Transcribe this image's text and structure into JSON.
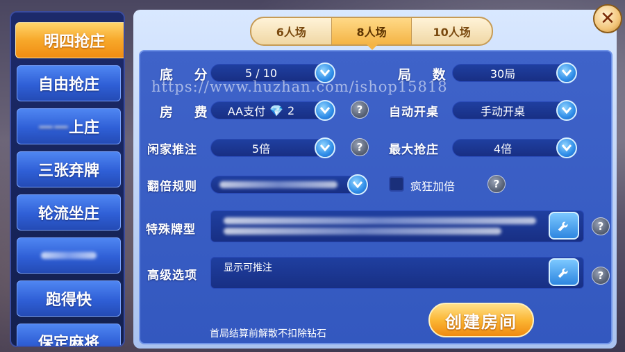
{
  "sidebar": {
    "items": [
      {
        "label": "明四抢庄"
      },
      {
        "label": "自由抢庄"
      },
      {
        "label": "上庄"
      },
      {
        "label": "三张弃牌"
      },
      {
        "label": "轮流坐庄"
      },
      {
        "label": ""
      },
      {
        "label": "跑得快"
      },
      {
        "label": "保定麻将"
      }
    ]
  },
  "tabs": [
    {
      "label": "6人场"
    },
    {
      "label": "8人场"
    },
    {
      "label": "10人场"
    }
  ],
  "close": {
    "label": "✕"
  },
  "form": {
    "difen": {
      "label": "底 分",
      "value": "5 / 10"
    },
    "jushu": {
      "label": "局 数",
      "value": "30局"
    },
    "fangfei": {
      "label": "房 费",
      "value_prefix": "AA支付",
      "value_suffix": "2"
    },
    "zidong": {
      "label": "自动开桌",
      "value": "手动开桌"
    },
    "xianjia": {
      "label": "闲家推注",
      "value": "5倍"
    },
    "zuida": {
      "label": "最大抢庄",
      "value": "4倍"
    },
    "fanbei": {
      "label": "翻倍规则",
      "value": ""
    },
    "crazy": {
      "label": "疯狂加倍"
    },
    "teshu": {
      "label": "特殊牌型"
    },
    "gaoji": {
      "label": "高级选项",
      "value": "显示可推注"
    }
  },
  "help_label": "?",
  "footer_note": "首局结算前解散不扣除钻石",
  "create_button": "创建房间",
  "watermark": "https://www.huzhan.com/ishop15818",
  "colors": {
    "accent": "#f4b445",
    "panel": "#3358bf"
  }
}
